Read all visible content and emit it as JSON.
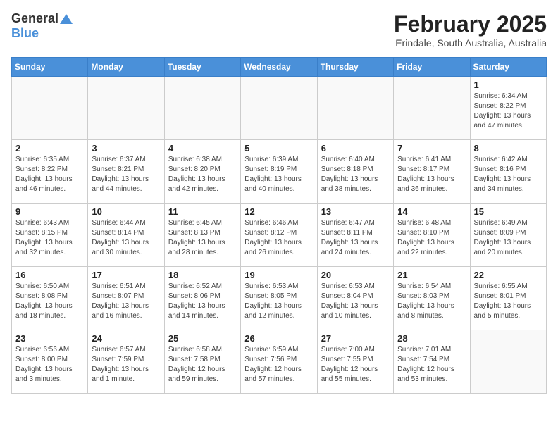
{
  "header": {
    "logo_general": "General",
    "logo_blue": "Blue",
    "month_title": "February 2025",
    "location": "Erindale, South Australia, Australia"
  },
  "weekdays": [
    "Sunday",
    "Monday",
    "Tuesday",
    "Wednesday",
    "Thursday",
    "Friday",
    "Saturday"
  ],
  "weeks": [
    [
      {
        "day": "",
        "info": ""
      },
      {
        "day": "",
        "info": ""
      },
      {
        "day": "",
        "info": ""
      },
      {
        "day": "",
        "info": ""
      },
      {
        "day": "",
        "info": ""
      },
      {
        "day": "",
        "info": ""
      },
      {
        "day": "1",
        "info": "Sunrise: 6:34 AM\nSunset: 8:22 PM\nDaylight: 13 hours and 47 minutes."
      }
    ],
    [
      {
        "day": "2",
        "info": "Sunrise: 6:35 AM\nSunset: 8:22 PM\nDaylight: 13 hours and 46 minutes."
      },
      {
        "day": "3",
        "info": "Sunrise: 6:37 AM\nSunset: 8:21 PM\nDaylight: 13 hours and 44 minutes."
      },
      {
        "day": "4",
        "info": "Sunrise: 6:38 AM\nSunset: 8:20 PM\nDaylight: 13 hours and 42 minutes."
      },
      {
        "day": "5",
        "info": "Sunrise: 6:39 AM\nSunset: 8:19 PM\nDaylight: 13 hours and 40 minutes."
      },
      {
        "day": "6",
        "info": "Sunrise: 6:40 AM\nSunset: 8:18 PM\nDaylight: 13 hours and 38 minutes."
      },
      {
        "day": "7",
        "info": "Sunrise: 6:41 AM\nSunset: 8:17 PM\nDaylight: 13 hours and 36 minutes."
      },
      {
        "day": "8",
        "info": "Sunrise: 6:42 AM\nSunset: 8:16 PM\nDaylight: 13 hours and 34 minutes."
      }
    ],
    [
      {
        "day": "9",
        "info": "Sunrise: 6:43 AM\nSunset: 8:15 PM\nDaylight: 13 hours and 32 minutes."
      },
      {
        "day": "10",
        "info": "Sunrise: 6:44 AM\nSunset: 8:14 PM\nDaylight: 13 hours and 30 minutes."
      },
      {
        "day": "11",
        "info": "Sunrise: 6:45 AM\nSunset: 8:13 PM\nDaylight: 13 hours and 28 minutes."
      },
      {
        "day": "12",
        "info": "Sunrise: 6:46 AM\nSunset: 8:12 PM\nDaylight: 13 hours and 26 minutes."
      },
      {
        "day": "13",
        "info": "Sunrise: 6:47 AM\nSunset: 8:11 PM\nDaylight: 13 hours and 24 minutes."
      },
      {
        "day": "14",
        "info": "Sunrise: 6:48 AM\nSunset: 8:10 PM\nDaylight: 13 hours and 22 minutes."
      },
      {
        "day": "15",
        "info": "Sunrise: 6:49 AM\nSunset: 8:09 PM\nDaylight: 13 hours and 20 minutes."
      }
    ],
    [
      {
        "day": "16",
        "info": "Sunrise: 6:50 AM\nSunset: 8:08 PM\nDaylight: 13 hours and 18 minutes."
      },
      {
        "day": "17",
        "info": "Sunrise: 6:51 AM\nSunset: 8:07 PM\nDaylight: 13 hours and 16 minutes."
      },
      {
        "day": "18",
        "info": "Sunrise: 6:52 AM\nSunset: 8:06 PM\nDaylight: 13 hours and 14 minutes."
      },
      {
        "day": "19",
        "info": "Sunrise: 6:53 AM\nSunset: 8:05 PM\nDaylight: 13 hours and 12 minutes."
      },
      {
        "day": "20",
        "info": "Sunrise: 6:53 AM\nSunset: 8:04 PM\nDaylight: 13 hours and 10 minutes."
      },
      {
        "day": "21",
        "info": "Sunrise: 6:54 AM\nSunset: 8:03 PM\nDaylight: 13 hours and 8 minutes."
      },
      {
        "day": "22",
        "info": "Sunrise: 6:55 AM\nSunset: 8:01 PM\nDaylight: 13 hours and 5 minutes."
      }
    ],
    [
      {
        "day": "23",
        "info": "Sunrise: 6:56 AM\nSunset: 8:00 PM\nDaylight: 13 hours and 3 minutes."
      },
      {
        "day": "24",
        "info": "Sunrise: 6:57 AM\nSunset: 7:59 PM\nDaylight: 13 hours and 1 minute."
      },
      {
        "day": "25",
        "info": "Sunrise: 6:58 AM\nSunset: 7:58 PM\nDaylight: 12 hours and 59 minutes."
      },
      {
        "day": "26",
        "info": "Sunrise: 6:59 AM\nSunset: 7:56 PM\nDaylight: 12 hours and 57 minutes."
      },
      {
        "day": "27",
        "info": "Sunrise: 7:00 AM\nSunset: 7:55 PM\nDaylight: 12 hours and 55 minutes."
      },
      {
        "day": "28",
        "info": "Sunrise: 7:01 AM\nSunset: 7:54 PM\nDaylight: 12 hours and 53 minutes."
      },
      {
        "day": "",
        "info": ""
      }
    ]
  ]
}
